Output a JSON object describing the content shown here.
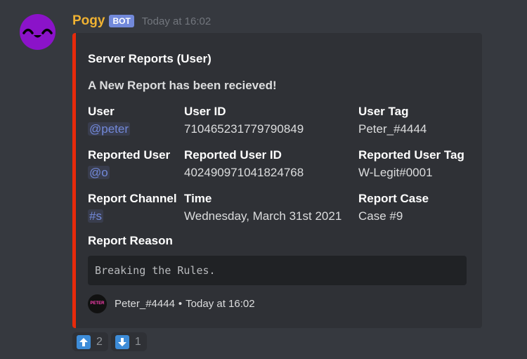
{
  "message": {
    "username": "Pogy",
    "bot_tag": "BOT",
    "timestamp": "Today at 16:02"
  },
  "embed": {
    "accent_color": "#e72a0b",
    "title": "Server Reports (User)",
    "description": "A New Report has been recieved!",
    "fields": {
      "user": {
        "name": "User",
        "value": "@peter"
      },
      "user_id": {
        "name": "User ID",
        "value": "710465231779790849"
      },
      "user_tag": {
        "name": "User Tag",
        "value": "Peter_#4444"
      },
      "reported_user": {
        "name": "Reported User",
        "value": "@o"
      },
      "reported_user_id": {
        "name": "Reported User ID",
        "value": "402490971041824768"
      },
      "reported_user_tag": {
        "name": "Reported User Tag",
        "value": "W-Legit#0001"
      },
      "report_channel": {
        "name": "Report Channel",
        "value": "#s"
      },
      "time": {
        "name": "Time",
        "value": "Wednesday, March 31st 2021"
      },
      "report_case": {
        "name": "Report Case",
        "value": "Case #9"
      }
    },
    "reason_label": "Report Reason",
    "reason": "Breaking the Rules.",
    "footer": {
      "icon_text": "PETER",
      "text": "Peter_#4444",
      "separator": "•",
      "timestamp": "Today at 16:02"
    }
  },
  "reactions": [
    {
      "icon": "up-arrow-icon",
      "count": "2"
    },
    {
      "icon": "down-arrow-icon",
      "count": "1"
    }
  ]
}
